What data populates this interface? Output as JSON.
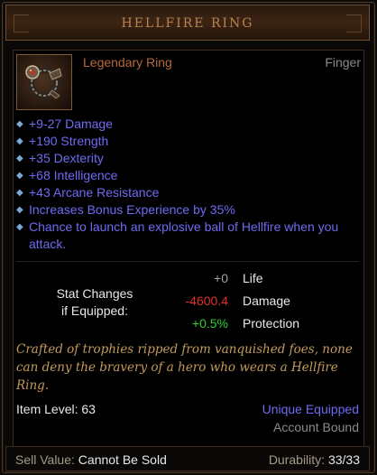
{
  "item": {
    "name": "HELLFIRE RING",
    "type": "Legendary Ring",
    "slot": "Finger",
    "icon": "ring-icon"
  },
  "affixes": [
    "+9-27 Damage",
    "+190 Strength",
    "+35 Dexterity",
    "+68 Intelligence",
    "+43 Arcane Resistance",
    "Increases Bonus Experience by 35%",
    "Chance to launch an explosive ball of Hellfire when you attack."
  ],
  "stat_changes": {
    "label_line1": "Stat Changes",
    "label_line2": "if Equipped:",
    "rows": [
      {
        "value": "+0",
        "name": "Life",
        "color": "#a0a0a0"
      },
      {
        "value": "-4600.4",
        "name": "Damage",
        "color": "#e0302a"
      },
      {
        "value": "+0.5%",
        "name": "Protection",
        "color": "#2fd02f"
      }
    ]
  },
  "flavor": "Crafted of trophies ripped from vanquished foes, none can deny the bravery of a hero who wears a Hellfire Ring.",
  "item_level": "Item Level: 63",
  "unique_equipped": "Unique Equipped",
  "account_bound": "Account Bound",
  "footer": {
    "sell_label": "Sell Value:",
    "sell_value": "Cannot Be Sold",
    "durability_label": "Durability:",
    "durability_value": "33/33"
  },
  "colors": {
    "legendary": "#b7693d",
    "magic_affix": "#6f6af2",
    "flavor": "#c39a5a",
    "title": "#b88352"
  }
}
